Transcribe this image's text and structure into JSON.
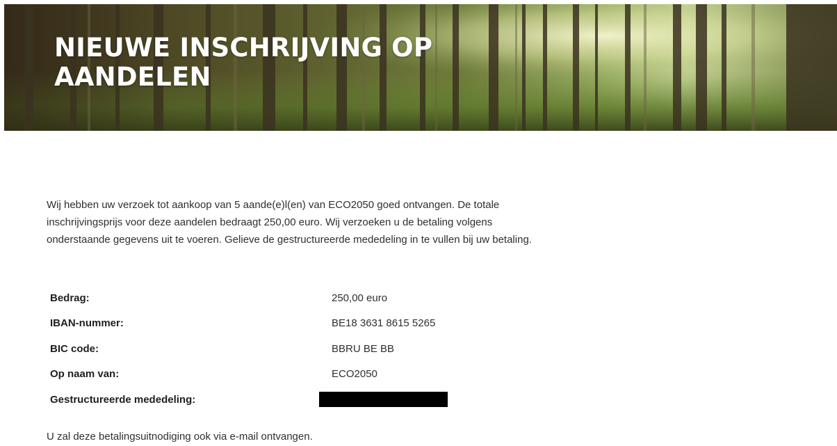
{
  "hero": {
    "title_line1": "NIEUWE INSCHRIJVING OP",
    "title_line2": "AANDELEN"
  },
  "intro": {
    "text": "Wij hebben uw verzoek tot aankoop van 5 aande(e)l(en) van ECO2050 goed ontvangen. De totale inschrijvingsprijs voor deze aandelen bedraagt 250,00 euro. Wij verzoeken u de betaling volgens onderstaande gegevens uit te voeren. Gelieve de gestructureerde mededeling in te vullen bij uw betaling."
  },
  "payment": {
    "rows": [
      {
        "label": "Bedrag:",
        "value": "250,00 euro"
      },
      {
        "label": "IBAN-nummer:",
        "value": "BE18 3631 8615 5265"
      },
      {
        "label": "BIC code:",
        "value": "BBRU BE BB"
      },
      {
        "label": "Op naam van:",
        "value": "ECO2050"
      },
      {
        "label": "Gestructureerde mededeling:",
        "value": ""
      }
    ]
  },
  "footer": {
    "note": "U zal deze betalingsuitnodiging ook via e-mail ontvangen."
  },
  "colors": {
    "background": "#ffffff",
    "text": "#2f2f2f",
    "hero_title": "#ffffff",
    "redaction": "#000000"
  }
}
